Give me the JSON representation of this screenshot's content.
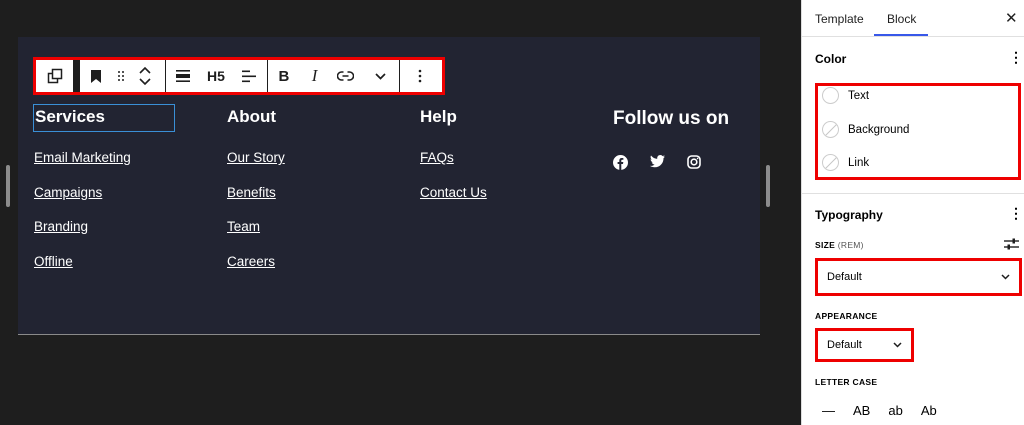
{
  "toolbar": {
    "heading_level": "H5",
    "bold": "B",
    "italic": "I"
  },
  "footer": {
    "columns": [
      {
        "heading": "Services",
        "links": [
          "Email Marketing",
          "Campaigns",
          "Branding",
          "Offline"
        ]
      },
      {
        "heading": "About",
        "links": [
          "Our Story",
          "Benefits",
          "Team",
          "Careers"
        ]
      },
      {
        "heading": "Help",
        "links": [
          "FAQs",
          "Contact Us"
        ]
      }
    ],
    "follow_heading": "Follow us on",
    "social_icons": [
      "facebook-icon",
      "twitter-icon",
      "instagram-icon"
    ]
  },
  "sidebar": {
    "tabs": [
      "Template",
      "Block"
    ],
    "active_tab": "Block",
    "color": {
      "title": "Color",
      "items": [
        "Text",
        "Background",
        "Link"
      ]
    },
    "typography": {
      "title": "Typography",
      "size_label": "SIZE",
      "size_unit": "(REM)",
      "size_value": "Default",
      "appearance_label": "APPEARANCE",
      "appearance_value": "Default",
      "letter_case_label": "LETTER CASE",
      "letter_case_options": [
        "—",
        "AB",
        "ab",
        "Ab"
      ]
    }
  },
  "colors": {
    "canvas_bg": "#222432",
    "outer_bg": "#1e1e1e",
    "highlight": "#e00000",
    "accent": "#3858e9"
  }
}
